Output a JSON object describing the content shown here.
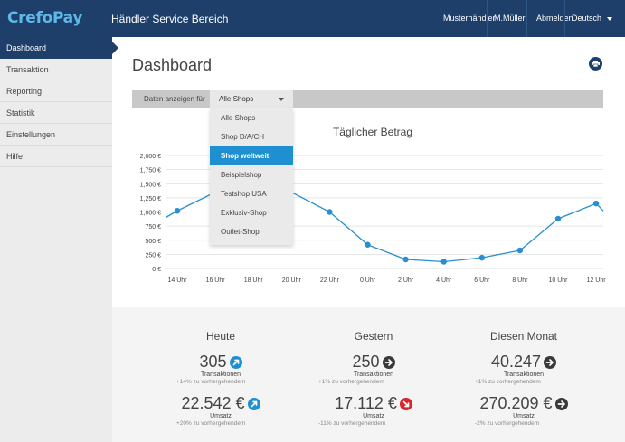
{
  "header": {
    "logo": "CrefoPay",
    "title": "Händler Service Bereich",
    "links": [
      "Musterhändler",
      "M.Müller",
      "Abmelden"
    ],
    "language": "Deutsch"
  },
  "sidebar": {
    "items": [
      {
        "label": "Dashboard",
        "active": true
      },
      {
        "label": "Transaktion"
      },
      {
        "label": "Reporting"
      },
      {
        "label": "Statistik"
      },
      {
        "label": "Einstellungen"
      },
      {
        "label": "Hilfe"
      }
    ]
  },
  "main": {
    "title": "Dashboard",
    "filter": {
      "label": "Daten anzeigen für",
      "selected": "Alle Shops",
      "options": [
        "Alle Shops",
        "Shop D/A/CH",
        "Shop weltweit",
        "Beispielshop",
        "Testshop USA",
        "Exklusiv-Shop",
        "Outlet-Shop"
      ],
      "highlighted": "Shop weltweit"
    }
  },
  "chart_data": {
    "type": "line",
    "title": "Täglicher Betrag",
    "categories": [
      "14 Uhr",
      "16 Uhr",
      "18 Uhr",
      "20 Uhr",
      "22 Uhr",
      "0 Uhr",
      "2 Uhr",
      "4 Uhr",
      "6 Uhr",
      "8 Uhr",
      "10 Uhr",
      "12 Uhr"
    ],
    "y_ticks": [
      "2,000 €",
      "1,750 €",
      "1,500 €",
      "1,250 €",
      "1,000 €",
      "750 €",
      "500 €",
      "250 €",
      "0 €"
    ],
    "ylim": [
      0,
      2000
    ],
    "series": [
      {
        "x": [
          13,
          14,
          16,
          18,
          22,
          0,
          2,
          4,
          6,
          8,
          10,
          12,
          13
        ],
        "values": [
          900,
          1020,
          1350,
          1700,
          1000,
          420,
          160,
          120,
          190,
          320,
          880,
          1150,
          1020
        ],
        "markers": [
          false,
          true,
          true,
          true,
          true,
          true,
          true,
          true,
          true,
          true,
          true,
          true,
          false
        ]
      }
    ],
    "colors": {
      "line": "#2a8fd0",
      "grid": "#dddddd"
    },
    "grid": true
  },
  "stats": [
    {
      "heading": "Heute",
      "transactions": "305",
      "transactions_label": "Transaktionen",
      "transactions_change": "+14% zu vorhergehendem",
      "transactions_trend": "up",
      "amount": "22.542 €",
      "amount_label": "Umsatz",
      "amount_change": "+20% zu vorhergehendem",
      "amount_trend": "up"
    },
    {
      "heading": "Gestern",
      "transactions": "250",
      "transactions_label": "Transaktionen",
      "transactions_change": "+1% zu vorhergehendem",
      "transactions_trend": "flat",
      "amount": "17.112 €",
      "amount_label": "Umsatz",
      "amount_change": "-11% zu vorhergehendem",
      "amount_trend": "down"
    },
    {
      "heading": "Diesen Monat",
      "transactions": "40.247",
      "transactions_label": "Transaktionen",
      "transactions_change": "+1% zu vorhergehendem",
      "transactions_trend": "flat",
      "amount": "270.209 €",
      "amount_label": "Umsatz",
      "amount_change": "-2% zu vorhergehendem",
      "amount_trend": "flat"
    }
  ],
  "trend_colors": {
    "up": "#1e90d2",
    "flat": "#3a3a3a",
    "down": "#d9262b"
  }
}
